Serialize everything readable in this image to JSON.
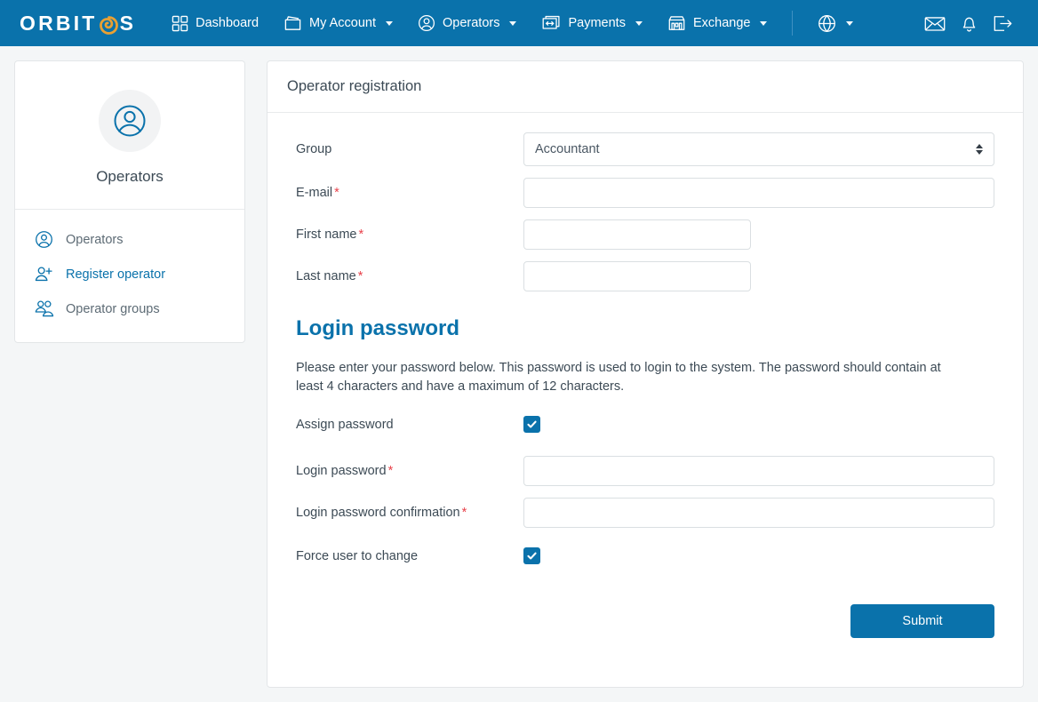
{
  "brand": {
    "text_before": "ORBIT",
    "swirl": "orbit-swirl-logo",
    "text_after": "S",
    "accent": "#e8a033"
  },
  "navbar": {
    "bg": "#0a72ab",
    "items": [
      {
        "label": "Dashboard",
        "icon": "grid-icon",
        "caret": false
      },
      {
        "label": "My Account",
        "icon": "wallet-icon",
        "caret": true
      },
      {
        "label": "Operators",
        "icon": "user-circle-icon",
        "caret": true
      },
      {
        "label": "Payments",
        "icon": "payments-icon",
        "caret": true
      },
      {
        "label": "Exchange",
        "icon": "shop-icon",
        "caret": true
      }
    ],
    "language": {
      "icon": "globe-icon",
      "caret": true
    },
    "right_icons": [
      {
        "name": "mail-icon"
      },
      {
        "name": "bell-icon"
      },
      {
        "name": "logout-icon"
      }
    ]
  },
  "sidebar": {
    "avatar_icon": "user-circle-icon",
    "title": "Operators",
    "items": [
      {
        "label": "Operators",
        "icon": "user-circle-icon",
        "active": false
      },
      {
        "label": "Register operator",
        "icon": "user-plus-icon",
        "active": true
      },
      {
        "label": "Operator groups",
        "icon": "users-icon",
        "active": false
      }
    ]
  },
  "main": {
    "title": "Operator registration",
    "fields": {
      "group": {
        "label": "Group",
        "required": false,
        "value": "Accountant",
        "placeholder": ""
      },
      "email": {
        "label": "E-mail",
        "required": true,
        "value": "",
        "placeholder": ""
      },
      "first_name": {
        "label": "First name",
        "required": true,
        "value": "",
        "placeholder": ""
      },
      "last_name": {
        "label": "Last name",
        "required": true,
        "value": "",
        "placeholder": ""
      }
    },
    "password_section": {
      "heading": "Login password",
      "description": "Please enter your password below. This password is used to login to the system. The password should contain at least 4 characters and have a maximum of 12 characters.",
      "assign_password": {
        "label": "Assign password",
        "checked": true
      },
      "login_password": {
        "label": "Login password",
        "required": true,
        "value": "",
        "placeholder": ""
      },
      "password_confirm": {
        "label": "Login password confirmation",
        "required": true,
        "value": "",
        "placeholder": ""
      },
      "force_change": {
        "label": "Force user to change",
        "checked": true
      }
    },
    "submit_label": "Submit"
  },
  "colors": {
    "accent": "#0a72ab",
    "required": "#e8414a",
    "logo_accent": "#e8a033",
    "page_bg": "#f4f6f7"
  }
}
